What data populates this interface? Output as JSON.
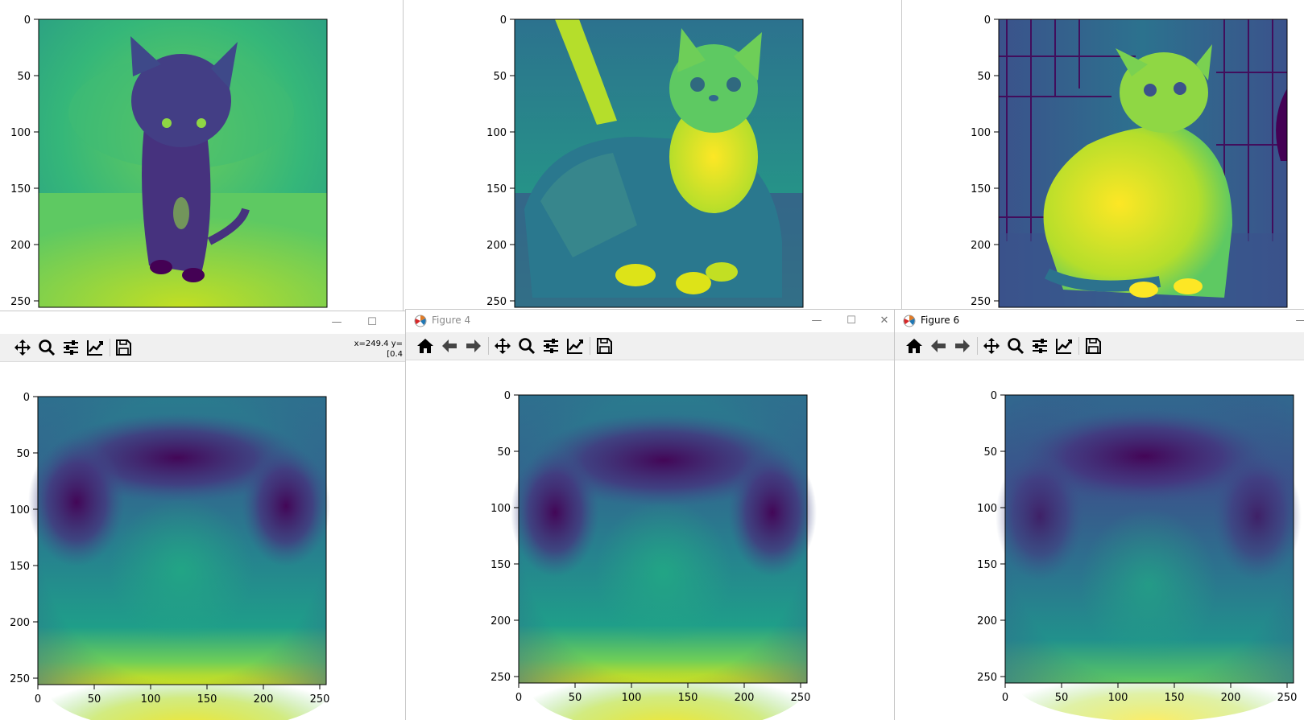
{
  "colors": {
    "viridis_dark": "#440154",
    "viridis_mid": "#21918c",
    "viridis_bright": "#fde725",
    "toolbar_bg": "#f0f0f0"
  },
  "toolbar_icons": [
    "home-icon",
    "back-arrow-icon",
    "forward-arrow-icon",
    "pan-icon",
    "zoom-icon",
    "configure-subplots-icon",
    "edit-axes-icon",
    "save-icon"
  ],
  "window_controls": {
    "minimize": "—",
    "maximize": "☐",
    "close": "✕"
  },
  "windows": {
    "left": {
      "title": "",
      "coord_line1": "x=249.4 y=",
      "coord_line2": "[0.4"
    },
    "middle": {
      "title": "Figure 4"
    },
    "right": {
      "title": "Figure 6"
    }
  },
  "ticks": {
    "y": [
      "0",
      "50",
      "100",
      "150",
      "200",
      "250"
    ],
    "x": [
      "0",
      "50",
      "100",
      "150",
      "200",
      "250"
    ]
  },
  "chart_data": [
    {
      "type": "heatmap",
      "content": "grayscale kitten photo rendered with viridis colormap",
      "xlim": [
        0,
        256
      ],
      "ylim": [
        256,
        0
      ],
      "yticks": [
        0,
        50,
        100,
        150,
        200,
        250
      ],
      "colormap": "viridis"
    },
    {
      "type": "heatmap",
      "content": "grayscale tabby kitten photo rendered with viridis colormap",
      "xlim": [
        0,
        256
      ],
      "ylim": [
        256,
        0
      ],
      "yticks": [
        0,
        50,
        100,
        150,
        200,
        250
      ],
      "colormap": "viridis"
    },
    {
      "type": "heatmap",
      "content": "grayscale cat photo in cage rendered with viridis colormap",
      "xlim": [
        0,
        256
      ],
      "ylim": [
        256,
        0
      ],
      "yticks": [
        0,
        50,
        100,
        150,
        200,
        250
      ],
      "colormap": "viridis"
    },
    {
      "type": "heatmap",
      "content": "averaged feature map, dark arch shape, bright yellow band at bottom",
      "xlim": [
        0,
        256
      ],
      "ylim": [
        256,
        0
      ],
      "xticks": [
        0,
        50,
        100,
        150,
        200,
        250
      ],
      "yticks": [
        0,
        50,
        100,
        150,
        200,
        250
      ],
      "colormap": "viridis"
    },
    {
      "type": "heatmap",
      "content": "averaged feature map, dark arch shape, bright yellow band at bottom",
      "xlim": [
        0,
        256
      ],
      "ylim": [
        256,
        0
      ],
      "xticks": [
        0,
        50,
        100,
        150,
        200,
        250
      ],
      "yticks": [
        0,
        50,
        100,
        150,
        200,
        250
      ],
      "colormap": "viridis"
    },
    {
      "type": "heatmap",
      "content": "averaged feature map, dark arch shape, green band at bottom",
      "xlim": [
        0,
        256
      ],
      "ylim": [
        256,
        0
      ],
      "xticks": [
        0,
        50,
        100,
        150,
        200,
        250
      ],
      "yticks": [
        0,
        50,
        100,
        150,
        200,
        250
      ],
      "colormap": "viridis"
    }
  ]
}
